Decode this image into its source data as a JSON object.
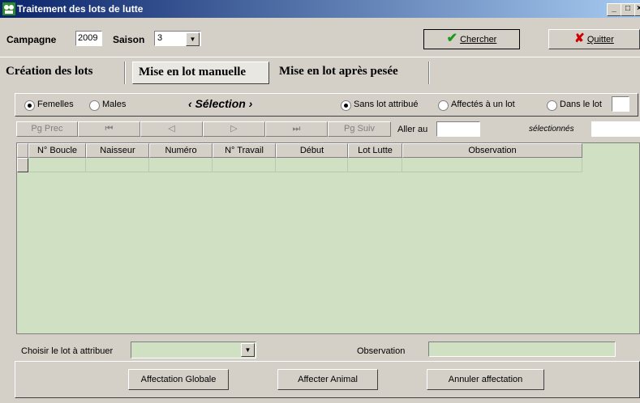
{
  "window": {
    "title": "Traitement des lots de lutte"
  },
  "top": {
    "campagne_label": "Campagne",
    "campagne_value": "2009",
    "saison_label": "Saison",
    "saison_value": "3",
    "search_label": "Chercher",
    "quit_label": "Quitter"
  },
  "tabs": [
    {
      "label": "Création des lots"
    },
    {
      "label": "Mise en lot manuelle"
    },
    {
      "label": "Mise en lot après pesée"
    }
  ],
  "filters": {
    "sex_options": [
      {
        "label": "Femelles",
        "selected": true
      },
      {
        "label": "Males",
        "selected": false
      }
    ],
    "selection_label": "‹ Sélection ›",
    "status_options": [
      {
        "label": "Sans lot attribué",
        "selected": true
      },
      {
        "label": "Affectés à un lot",
        "selected": false
      },
      {
        "label": "Dans le lot",
        "selected": false
      }
    ]
  },
  "nav": {
    "prev_page": "Pg Prec",
    "first": "⏮",
    "prev": "◁",
    "next": "▷",
    "last": "⏭",
    "next_page": "Pg Suiv",
    "goto_label": "Aller au",
    "selected_label": "sélectionnés"
  },
  "grid": {
    "columns": [
      "N° Boucle",
      "Naisseur",
      "Numéro",
      "N° Travail",
      "Début",
      "Lot Lutte",
      "Observation"
    ]
  },
  "bottom": {
    "choose_lot_label": "Choisir le lot à attribuer",
    "observation_label": "Observation",
    "buttons": [
      "Affectation Globale",
      "Affecter Animal",
      "Annuler affectation"
    ]
  },
  "colors": {
    "grid_bg": "#cfe0c3",
    "title_start": "#0a246a",
    "title_end": "#a6caf0"
  }
}
